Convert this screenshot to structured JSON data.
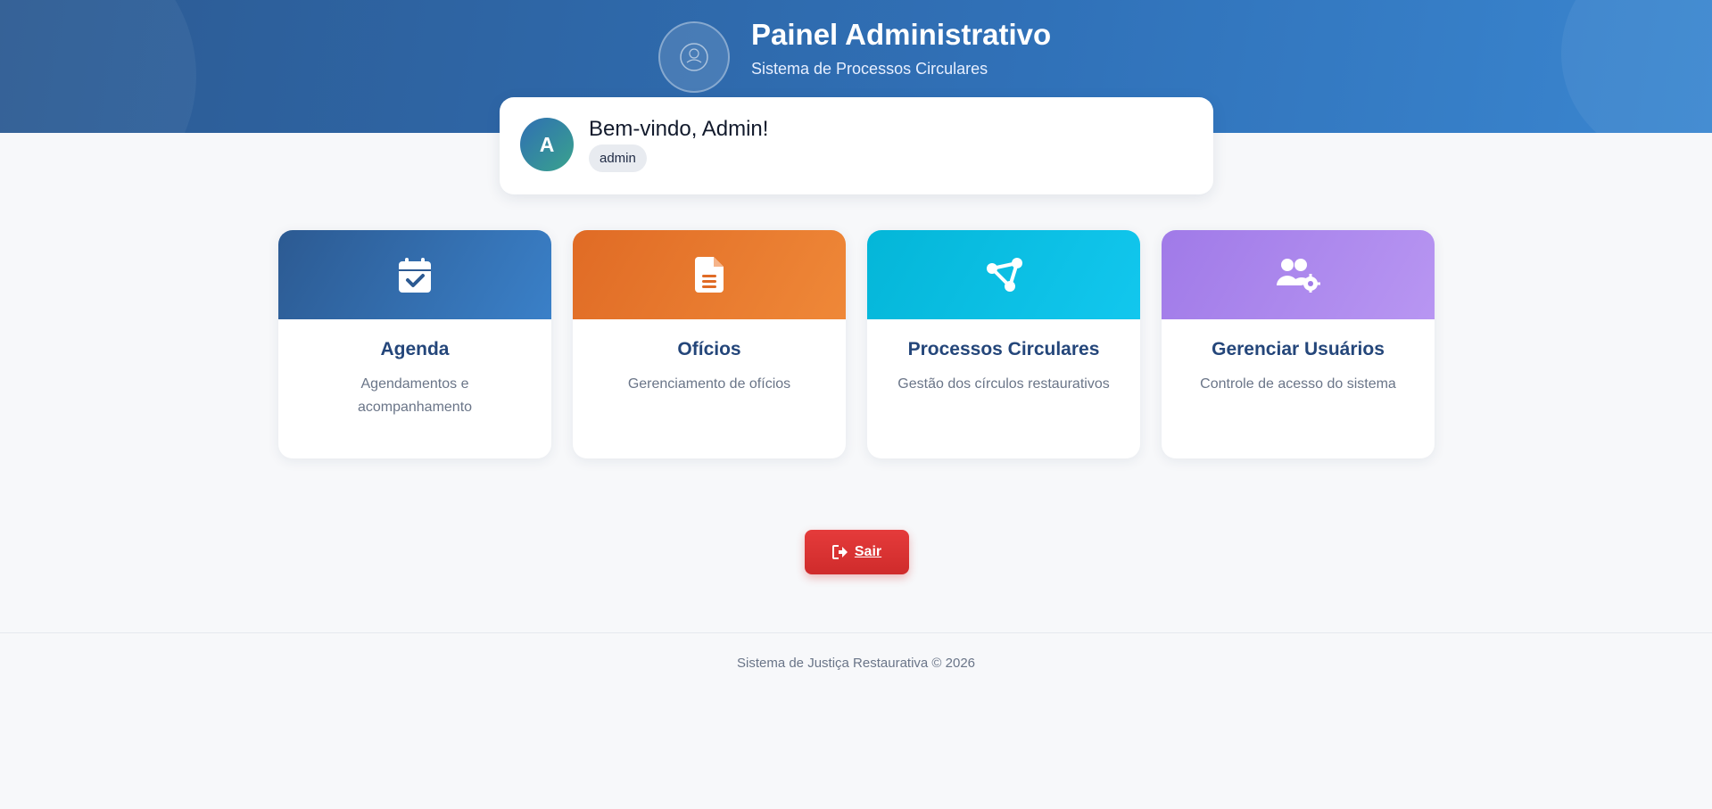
{
  "header": {
    "title": "Painel Administrativo",
    "subtitle": "Sistema de Processos Circulares",
    "logo_icon": "logo-icon"
  },
  "welcome": {
    "avatar_initial": "A",
    "greeting": "Bem-vindo, Admin!",
    "role": "admin"
  },
  "cards": [
    {
      "title": "Agenda",
      "description": "Agendamentos e acompanhamento",
      "icon": "calendar-check-icon",
      "color": "#2c5a92"
    },
    {
      "title": "Ofícios",
      "description": "Gerenciamento de ofícios",
      "icon": "file-lines-icon",
      "color": "#e06b25"
    },
    {
      "title": "Processos Circulares",
      "description": "Gestão dos círculos restaurativos",
      "icon": "circle-nodes-icon",
      "color": "#04b6d8"
    },
    {
      "title": "Gerenciar Usuários",
      "description": "Controle de acesso do sistema",
      "icon": "users-gear-icon",
      "color": "#a07ae8"
    }
  ],
  "logout": {
    "label": "Sair",
    "icon": "sign-out-icon",
    "color": "#e53b3b"
  },
  "footer": {
    "text": "Sistema de Justiça Restaurativa © 2026"
  }
}
